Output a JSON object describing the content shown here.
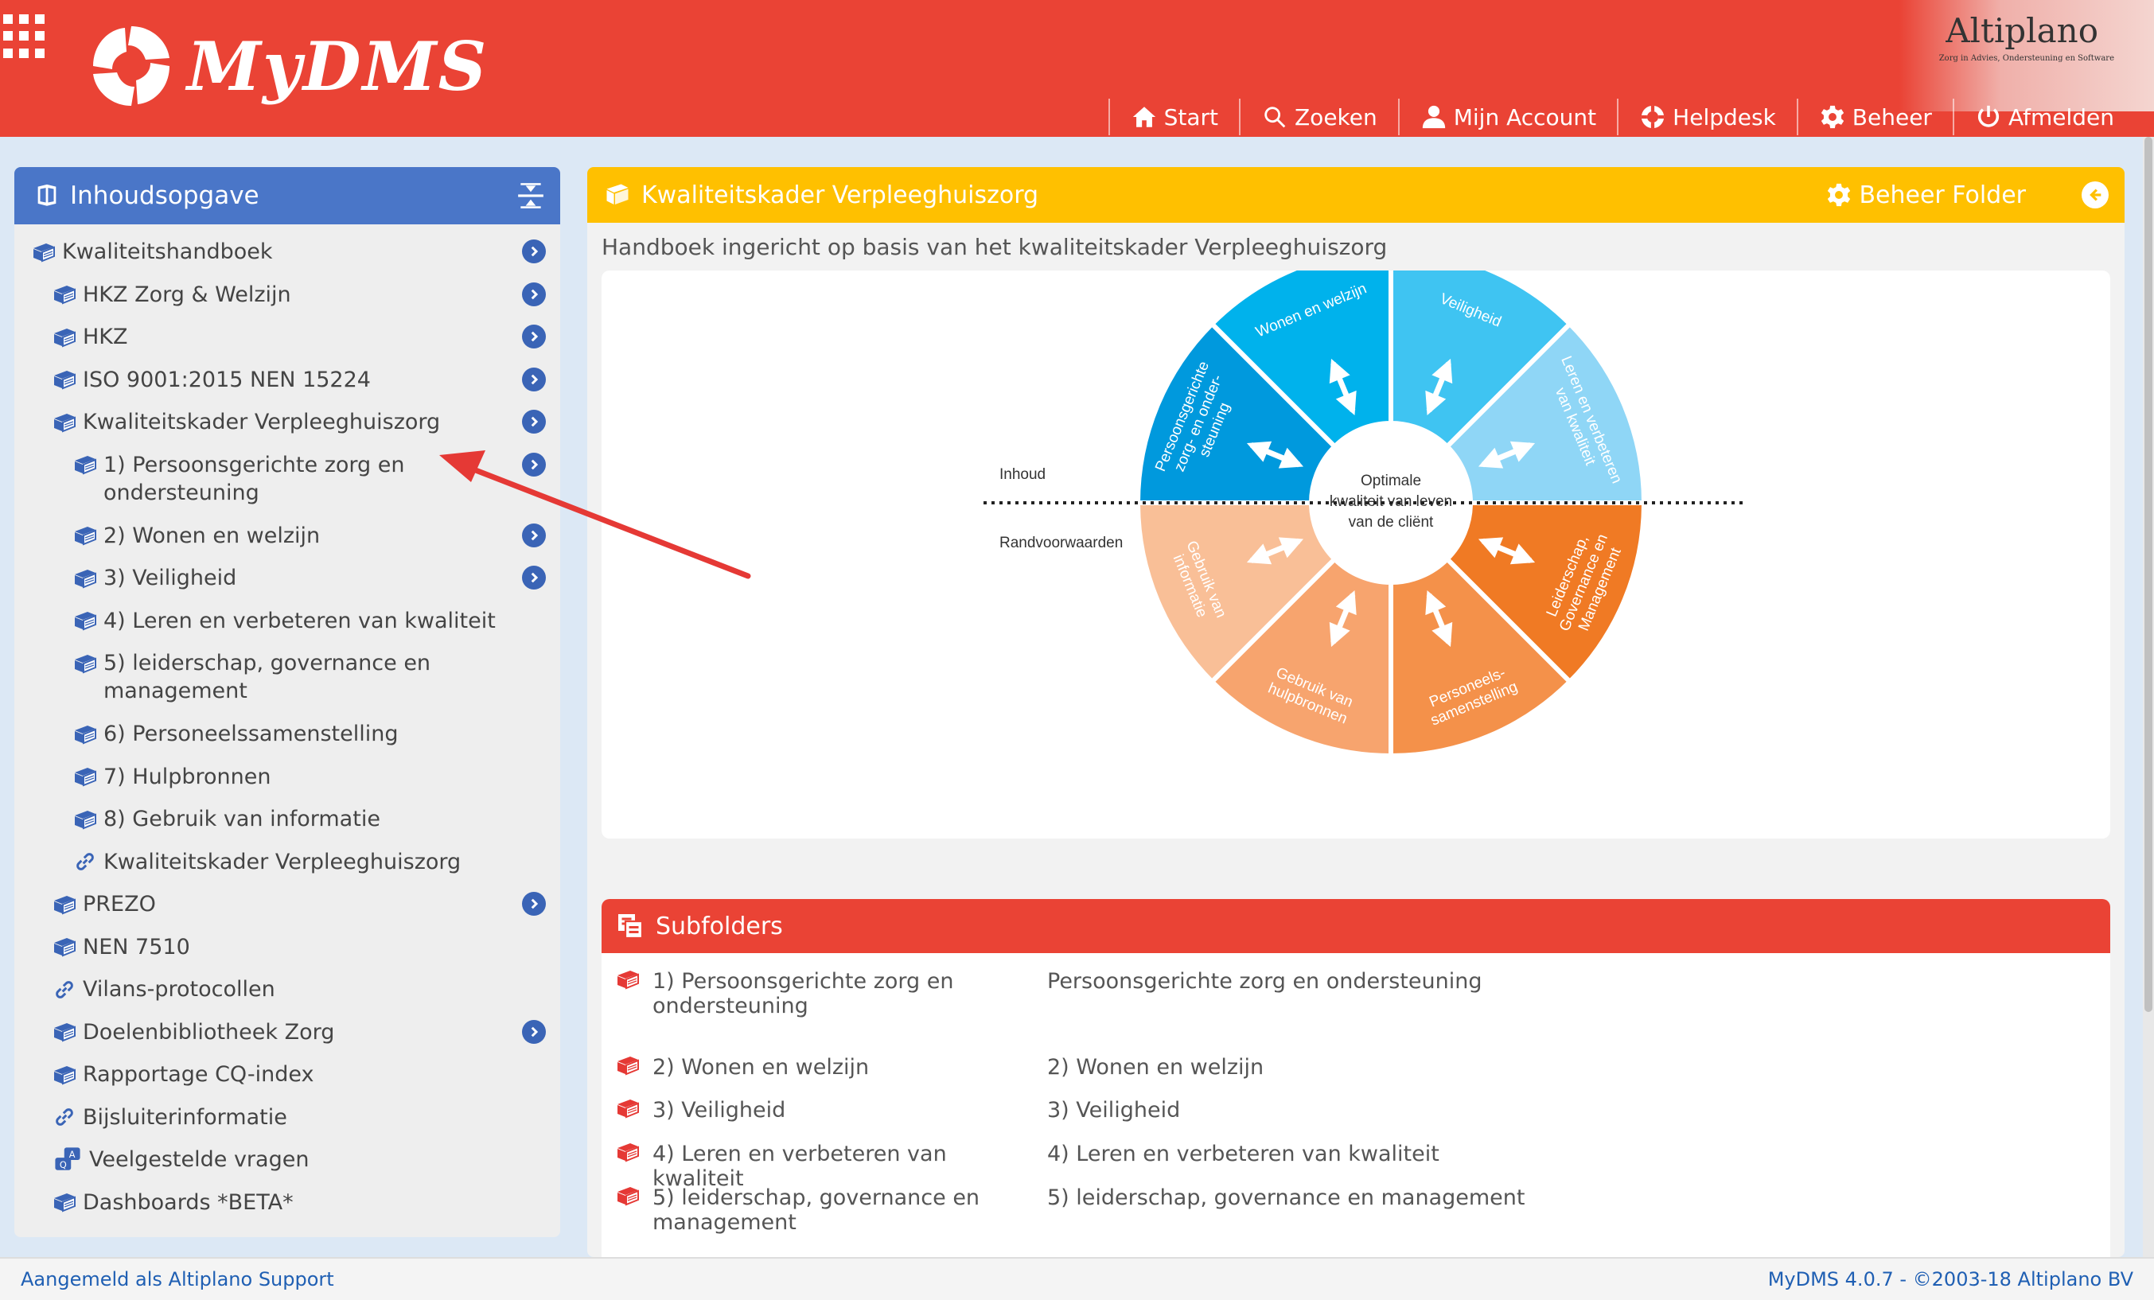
{
  "app": {
    "name": "MyDMS",
    "partner": "Altiplano",
    "partner_tagline": "Zorg in Advies, Ondersteuning en Software"
  },
  "nav": {
    "items": [
      {
        "label": "Start",
        "icon": "home-icon"
      },
      {
        "label": "Zoeken",
        "icon": "search-icon"
      },
      {
        "label": "Mijn Account",
        "icon": "user-icon"
      },
      {
        "label": "Helpdesk",
        "icon": "lifebuoy-icon"
      },
      {
        "label": "Beheer",
        "icon": "gear-icon"
      },
      {
        "label": "Afmelden",
        "icon": "power-icon"
      }
    ]
  },
  "sidebar": {
    "title": "Inhoudsopgave",
    "items": [
      {
        "label": "Kwaliteitshandboek",
        "level": 0,
        "icon": "book-icon",
        "has_arrow": true
      },
      {
        "label": "HKZ Zorg & Welzijn",
        "level": 1,
        "icon": "book-icon",
        "has_arrow": true
      },
      {
        "label": "HKZ",
        "level": 1,
        "icon": "book-icon",
        "has_arrow": true
      },
      {
        "label": "ISO 9001:2015 NEN 15224",
        "level": 1,
        "icon": "book-icon",
        "has_arrow": true
      },
      {
        "label": "Kwaliteitskader Verpleeghuiszorg",
        "level": 1,
        "icon": "book-icon",
        "has_arrow": true
      },
      {
        "label": "1) Persoonsgerichte zorg en ondersteuning",
        "level": 2,
        "icon": "book-icon",
        "has_arrow": true,
        "two_line": true
      },
      {
        "label": "2) Wonen en welzijn",
        "level": 2,
        "icon": "book-icon",
        "has_arrow": true
      },
      {
        "label": "3) Veiligheid",
        "level": 2,
        "icon": "book-icon",
        "has_arrow": true
      },
      {
        "label": "4) Leren en verbeteren van kwaliteit",
        "level": 2,
        "icon": "book-icon",
        "has_arrow": false
      },
      {
        "label": "5) leiderschap, governance en management",
        "level": 2,
        "icon": "book-icon",
        "has_arrow": false,
        "two_line": true
      },
      {
        "label": "6) Personeelssamenstelling",
        "level": 2,
        "icon": "book-icon",
        "has_arrow": false
      },
      {
        "label": "7) Hulpbronnen",
        "level": 2,
        "icon": "book-icon",
        "has_arrow": false
      },
      {
        "label": "8) Gebruik van informatie",
        "level": 2,
        "icon": "book-icon",
        "has_arrow": false
      },
      {
        "label": "Kwaliteitskader Verpleeghuiszorg",
        "level": 2,
        "icon": "link-icon",
        "has_arrow": false
      },
      {
        "label": "PREZO",
        "level": 1,
        "icon": "book-icon",
        "has_arrow": true
      },
      {
        "label": "NEN 7510",
        "level": 1,
        "icon": "book-icon",
        "has_arrow": false
      },
      {
        "label": "Vilans-protocollen",
        "level": 1,
        "icon": "link-icon",
        "has_arrow": false
      },
      {
        "label": "Doelenbibliotheek Zorg",
        "level": 1,
        "icon": "book-icon",
        "has_arrow": true
      },
      {
        "label": "Rapportage CQ-index",
        "level": 1,
        "icon": "book-icon",
        "has_arrow": false
      },
      {
        "label": "Bijsluiterinformatie",
        "level": 1,
        "icon": "link-icon",
        "has_arrow": false
      },
      {
        "label": "Veelgestelde vragen",
        "level": 1,
        "icon": "qa-icon",
        "has_arrow": false
      },
      {
        "label": "Dashboards *BETA*",
        "level": 1,
        "icon": "book-icon",
        "has_arrow": false
      }
    ]
  },
  "main": {
    "title": "Kwaliteitskader Verpleeghuiszorg",
    "beheer_folder": "Beheer Folder",
    "description": "Handboek ingericht op basis van het kwaliteitskader Verpleeghuiszorg"
  },
  "wheel": {
    "center": [
      "Optimale",
      "kwaliteit van leven",
      "van de cliënt"
    ],
    "label_top": "Inhoud",
    "label_bottom": "Randvoorwaarden",
    "segments": [
      {
        "lines": [
          "Wonen en welzijn"
        ],
        "color": "#00b2ec"
      },
      {
        "lines": [
          "Veiligheid"
        ],
        "color": "#3fc4f2"
      },
      {
        "lines": [
          "Leren en verbeteren",
          "van kwaliteit"
        ],
        "color": "#8fd6f6"
      },
      {
        "lines": [
          "Leiderschap,",
          "Governance en",
          "Management"
        ],
        "color": "#f07a24"
      },
      {
        "lines": [
          "Personeels-",
          "samenstelling"
        ],
        "color": "#f4914a"
      },
      {
        "lines": [
          "Gebruik van",
          "hulpbronnen"
        ],
        "color": "#f7a46e"
      },
      {
        "lines": [
          "Gebruik van",
          "informatie"
        ],
        "color": "#f9bf97"
      },
      {
        "lines": [
          "Persoonsgerichte",
          "zorg- en onder-",
          "steuning"
        ],
        "color": "#0099dd"
      }
    ]
  },
  "subfolders": {
    "title": "Subfolders",
    "rows": [
      {
        "name": "1) Persoonsgerichte zorg en ondersteuning",
        "description": "Persoonsgerichte zorg en ondersteuning"
      },
      {
        "name": "2) Wonen en welzijn",
        "description": "2) Wonen en welzijn"
      },
      {
        "name": "3) Veiligheid",
        "description": "3) Veiligheid"
      },
      {
        "name": "4) Leren en verbeteren van kwaliteit",
        "description": "4) Leren en verbeteren van kwaliteit"
      },
      {
        "name": "5) leiderschap, governance en management",
        "description": "5) leiderschap, governance en management"
      }
    ]
  },
  "footer": {
    "logged_in": "Aangemeld als Altiplano Support",
    "version": "MyDMS 4.0.7 - ©2003-18 Altiplano BV"
  },
  "colors": {
    "header": "#ea4335",
    "sidebar_header": "#4a76c8",
    "main_header": "#ffc000",
    "subfolders_header": "#ea4335",
    "annotation_arrow": "#e53935"
  }
}
